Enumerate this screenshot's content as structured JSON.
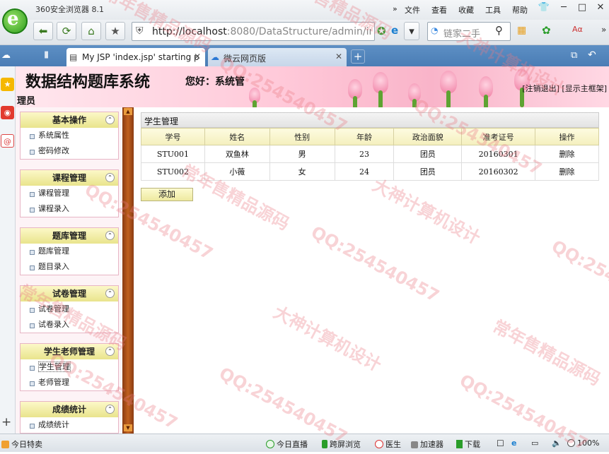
{
  "browser": {
    "title": "360安全浏览器 8.1",
    "menu": [
      "»",
      "文件",
      "查看",
      "收藏",
      "工具",
      "帮助"
    ],
    "url_host": "http://localhost",
    "url_rest": ":8080/DataStructure/admin/inc",
    "search_placeholder": "链家二手",
    "tabs": [
      {
        "label": "My JSP 'index.jsp' starting p"
      },
      {
        "label": "微云网页版"
      }
    ]
  },
  "header": {
    "system_title": "数据结构题库系统",
    "greeting": "您好：系统管",
    "greeting_cont": "理员",
    "logout_link": "[注销退出]",
    "main_frame_link": "[显示主框架]"
  },
  "sidebar": {
    "groups": [
      {
        "title": "基本操作",
        "items": [
          "系统属性",
          "密码修改"
        ]
      },
      {
        "title": "课程管理",
        "items": [
          "课程管理",
          "课程录入"
        ]
      },
      {
        "title": "题库管理",
        "items": [
          "题库管理",
          "题目录入"
        ]
      },
      {
        "title": "试卷管理",
        "items": [
          "试卷管理",
          "试卷录入"
        ]
      },
      {
        "title": "学生老师管理",
        "items": [
          "学生管理",
          "老师管理"
        ]
      },
      {
        "title": "成绩统计",
        "items": [
          "成绩统计"
        ]
      }
    ]
  },
  "main": {
    "panel_title": "学生管理",
    "columns": [
      "学号",
      "姓名",
      "性别",
      "年龄",
      "政治面貌",
      "准考证号",
      "操作"
    ],
    "rows": [
      [
        "STU001",
        "双鱼林",
        "男",
        "23",
        "团员",
        "20160301",
        "删除"
      ],
      [
        "STU002",
        "小薇",
        "女",
        "24",
        "团员",
        "20160302",
        "删除"
      ]
    ],
    "add_button": "添加"
  },
  "statusbar": {
    "left": "今日特卖",
    "items": [
      "今日直播",
      "跨屏浏览",
      "医生",
      "加速器",
      "下载"
    ],
    "zoom": "100%"
  },
  "watermarks": [
    "常年售精品源码",
    "大神计算机设计",
    "QQ:254540457"
  ]
}
